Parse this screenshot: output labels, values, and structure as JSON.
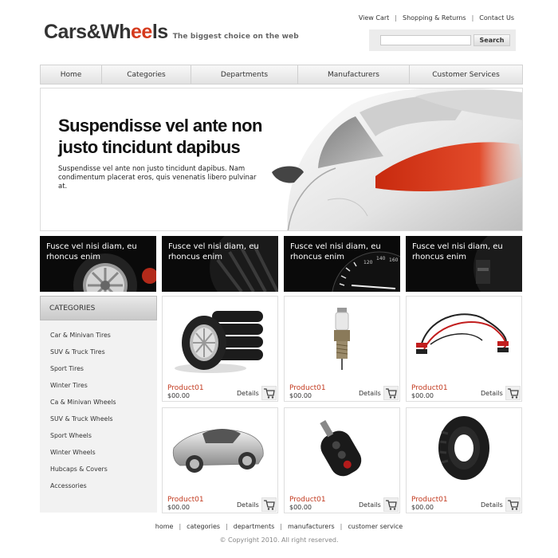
{
  "logo": {
    "part1": "Cars&Wh",
    "part2": "ee",
    "part3": "ls",
    "tagline": "The biggest choice on the web"
  },
  "toplinks": [
    "View Cart",
    "Shopping & Returns",
    "Contact Us"
  ],
  "search": {
    "placeholder": "",
    "button": "Search"
  },
  "nav": [
    "Home",
    "Categories",
    "Departments",
    "Manufacturers",
    "Customer Services"
  ],
  "hero": {
    "title": "Suspendisse vel ante non justo tincidunt dapibus",
    "text": "Suspendisse vel ante non justo tincidunt dapibus. Nam condimentum placerat eros, quis venenatis libero pulvinar at."
  },
  "promos": [
    {
      "text": "Fusce vel nisi diam, eu rhoncus enim",
      "image": "tire-rim-image"
    },
    {
      "text": "Fusce vel nisi diam, eu rhoncus enim",
      "image": "tire-tread-image"
    },
    {
      "text": "Fusce vel nisi diam, eu rhoncus enim",
      "image": "speedometer-image"
    },
    {
      "text": "Fusce vel nisi diam, eu rhoncus enim",
      "image": "dark-tire-image"
    }
  ],
  "sidebar": {
    "title": "CATEGORIES",
    "items": [
      "Car & Minivan Tires",
      "SUV & Truck Tires",
      "Sport Tires",
      "Winter Tires",
      "Ca & Minivan Wheels",
      "SUV & Truck Wheels",
      "Sport Wheels",
      "Winter Wheels",
      "Hubcaps & Covers",
      "Accessories"
    ]
  },
  "products": [
    {
      "name": "Product01",
      "price": "$00.00",
      "details": "Details",
      "image": "tire-stack-image"
    },
    {
      "name": "Product01",
      "price": "$00.00",
      "details": "Details",
      "image": "spark-plug-image"
    },
    {
      "name": "Product01",
      "price": "$00.00",
      "details": "Details",
      "image": "jumper-cables-image"
    },
    {
      "name": "Product01",
      "price": "$00.00",
      "details": "Details",
      "image": "silver-sports-car-image"
    },
    {
      "name": "Product01",
      "price": "$00.00",
      "details": "Details",
      "image": "car-key-remote-image"
    },
    {
      "name": "Product01",
      "price": "$00.00",
      "details": "Details",
      "image": "single-tire-image"
    }
  ],
  "footer": {
    "links": [
      "home",
      "categories",
      "departments",
      "manufacturers",
      "customer service"
    ],
    "copyright": "© Copyright 2010. All right reserved."
  },
  "colors": {
    "accent": "#d53a1d",
    "product_name": "#c23a1f",
    "promo_bg": "#0a0a0a",
    "sidebar_bg": "#f2f2f2"
  }
}
